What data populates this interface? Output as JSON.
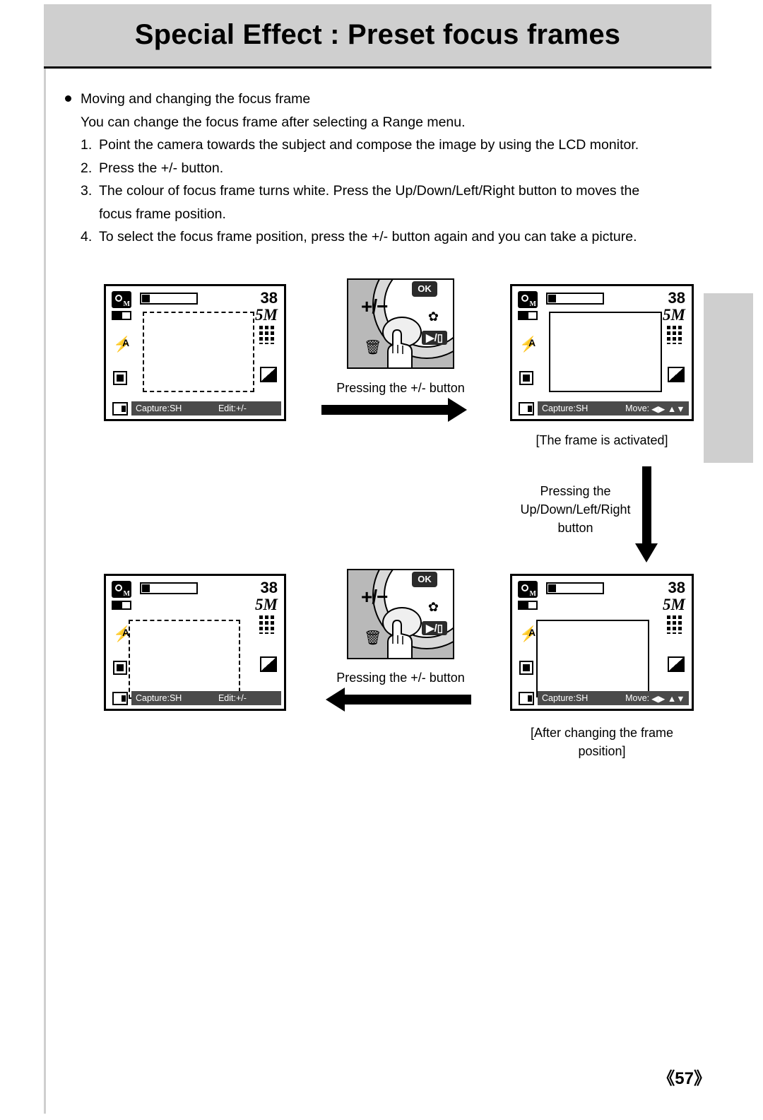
{
  "header": {
    "title": "Special Effect : Preset focus frames"
  },
  "body": {
    "bullet": "Moving and changing the focus frame",
    "subline": "You can change the focus frame after selecting a Range menu.",
    "steps": [
      {
        "num": "1.",
        "text": "Point the camera towards the subject and compose the image by using the LCD monitor."
      },
      {
        "num": "2.",
        "text": "Press the +/- button."
      },
      {
        "num": "3.",
        "text": "The colour of focus frame turns white. Press the Up/Down/Left/Right button to moves the"
      },
      {
        "num": "",
        "text": "focus frame position."
      },
      {
        "num": "4.",
        "text": "To select the focus frame position, press the +/- button again and you can take a picture."
      }
    ]
  },
  "figures": {
    "lcd1": {
      "shots": "38",
      "resolution": "5M",
      "flash": "A",
      "status_left": "Capture:SH",
      "status_right": "Edit:+/-"
    },
    "lcd2": {
      "shots": "38",
      "resolution": "5M",
      "flash": "A",
      "status_left": "Capture:SH",
      "status_right": "Move:",
      "status_right_arrows": "◀▶ ▲▼"
    },
    "lcd3": {
      "shots": "38",
      "resolution": "5M",
      "flash": "A",
      "status_left": "Capture:SH",
      "status_right": "Edit:+/-"
    },
    "lcd4": {
      "shots": "38",
      "resolution": "5M",
      "flash": "A",
      "status_left": "Capture:SH",
      "status_right": "Move:",
      "status_right_arrows": "◀▶ ▲▼"
    },
    "button_panel_top": {
      "ok_label": "OK",
      "plusminus_label": "+/−",
      "play_label": "▶/▯",
      "macro_label": "✿",
      "trash_label": "🗑"
    },
    "button_panel_bottom": {
      "ok_label": "OK",
      "plusminus_label": "+/−",
      "play_label": "▶/▯",
      "macro_label": "✿",
      "trash_label": "🗑"
    },
    "captions": {
      "press_plusminus_top": "Pressing the +/- button",
      "frame_activated": "[The frame is activated]",
      "press_arrows_line1": "Pressing the",
      "press_arrows_line2": "Up/Down/Left/Right",
      "press_arrows_line3": "button",
      "press_plusminus_bottom": "Pressing the +/- button",
      "after_changing_line1": "[After changing the frame",
      "after_changing_line2": "position]"
    }
  },
  "footer": {
    "page": "《57》"
  }
}
